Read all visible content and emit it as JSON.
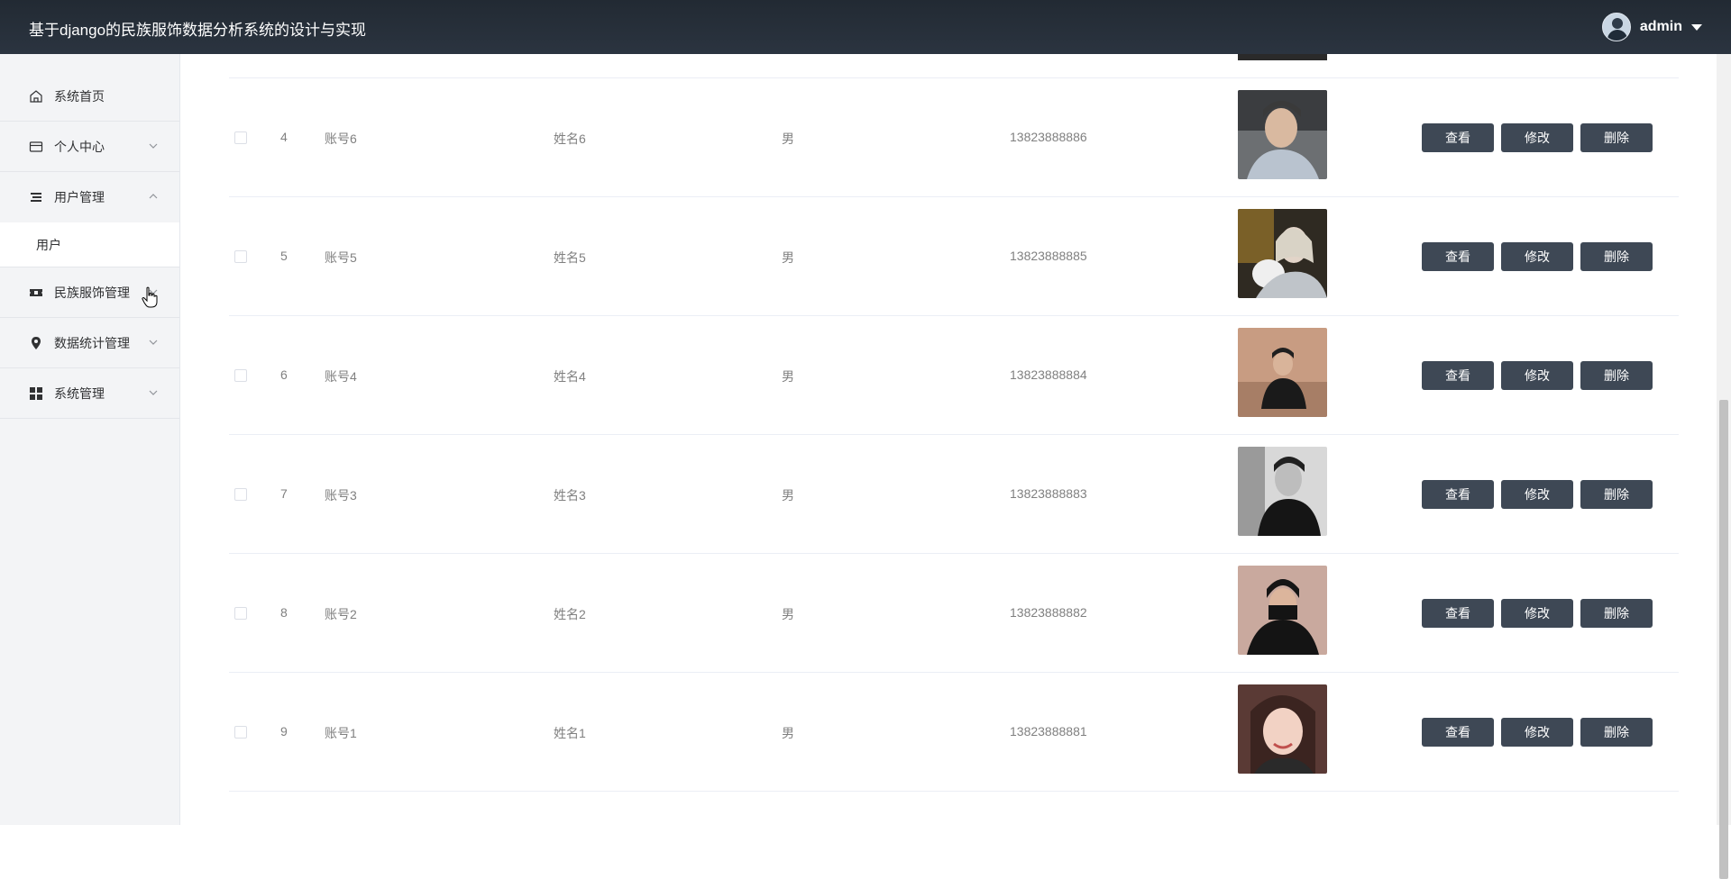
{
  "app": {
    "title": "基于django的民族服饰数据分析系统的设计与实现"
  },
  "user": {
    "name": "admin",
    "avatar_icon": "user-avatar"
  },
  "sidebar": {
    "items": [
      {
        "label": "系统首页",
        "icon": "home-icon"
      },
      {
        "label": "个人中心",
        "icon": "card-icon"
      },
      {
        "label": "用户管理",
        "icon": "list-icon"
      },
      {
        "label": "用户",
        "icon": ""
      },
      {
        "label": "民族服饰管理",
        "icon": "ticket-icon"
      },
      {
        "label": "数据统计管理",
        "icon": "pin-icon"
      },
      {
        "label": "系统管理",
        "icon": "grid-icon"
      }
    ]
  },
  "table": {
    "rows": [
      {
        "index": "4",
        "account": "账号6",
        "name": "姓名6",
        "sex": "男",
        "phone": "13823888886"
      },
      {
        "index": "5",
        "account": "账号5",
        "name": "姓名5",
        "sex": "男",
        "phone": "13823888885"
      },
      {
        "index": "6",
        "account": "账号4",
        "name": "姓名4",
        "sex": "男",
        "phone": "13823888884"
      },
      {
        "index": "7",
        "account": "账号3",
        "name": "姓名3",
        "sex": "男",
        "phone": "13823888883"
      },
      {
        "index": "8",
        "account": "账号2",
        "name": "姓名2",
        "sex": "男",
        "phone": "13823888882"
      },
      {
        "index": "9",
        "account": "账号1",
        "name": "姓名1",
        "sex": "男",
        "phone": "13823888881"
      }
    ],
    "actions": {
      "view": "查看",
      "edit": "修改",
      "delete": "删除"
    }
  },
  "colors": {
    "topbar": "#2b3440",
    "button": "#3e4855",
    "sidebar": "#f3f4f6"
  }
}
